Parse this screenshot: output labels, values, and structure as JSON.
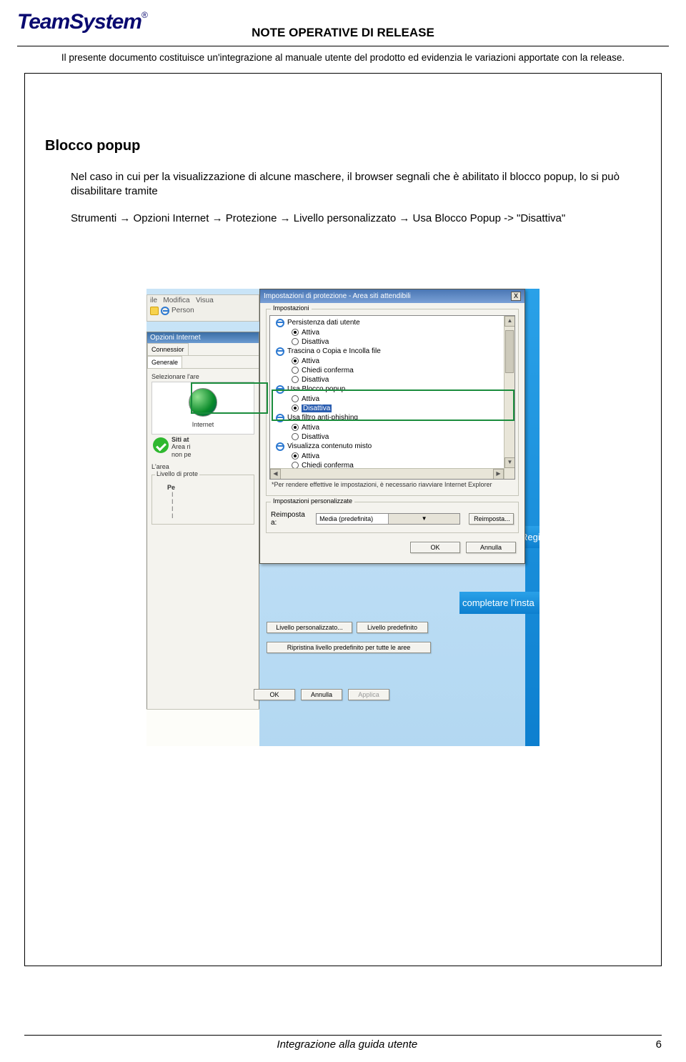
{
  "header": {
    "logo_text": "TeamSystem",
    "logo_reg": "®",
    "doc_title": "NOTE OPERATIVE DI RELEASE",
    "subtitle": "Il presente documento costituisce un'integrazione al manuale utente del prodotto ed evidenzia le variazioni apportate con la release."
  },
  "section": {
    "heading": "Blocco popup",
    "paragraph": "Nel caso in cui per la visualizzazione di alcune maschere, il browser segnali che è abilitato il blocco popup, lo si può disabilitare tramite",
    "path": "Strumenti → Opzioni Internet → Protezione → Livello personalizzato → Usa Blocco Popup -> \"Disattiva\""
  },
  "ie_menu": {
    "file": "ile",
    "modifica": "Modifica",
    "visua": "Visua",
    "person": "Person"
  },
  "opzioni": {
    "title": "Opzioni Internet",
    "tab_conn": "Connessior",
    "tab_gen": "Generale",
    "sel_area": "Selezionare l'are",
    "internet": "Internet",
    "siti_at": "Siti at",
    "area_ri": "Area ri",
    "non_pe": "non pe",
    "larea": "L'area",
    "livello_prote": "Livello di prote",
    "pe": "Pe",
    "btn_liv_pers": "Livello personalizzato...",
    "btn_liv_pred": "Livello predefinito",
    "btn_riprist": "Ripristina livello predefinito per tutte le aree",
    "btn_ok": "OK",
    "btn_annulla": "Annulla",
    "btn_applica": "Applica"
  },
  "dialog": {
    "title": "Impostazioni di protezione - Area siti attendibili",
    "close": "X",
    "grp_impost": "Impostazioni",
    "items": {
      "persist": "Persistenza dati utente",
      "attiva": "Attiva",
      "disatt": "Disattiva",
      "trascina": "Trascina o Copia e Incolla file",
      "chiedi": "Chiedi conferma",
      "usablocco": "Usa Blocco popup",
      "usafiltro": "Usa filtro anti-phishing",
      "visualizza": "Visualizza contenuto misto"
    },
    "note": "*Per rendere effettive le impostazioni, è necessario riavviare Internet Explorer",
    "grp_pers": "Impostazioni personalizzate",
    "reimp_label": "Reimposta a:",
    "combo_val": "Media (predefinita)",
    "btn_reimp": "Reimposta...",
    "btn_ok": "OK",
    "btn_ann": "Annulla"
  },
  "bluestrip": {
    "line1": "Regi",
    "line2": "completare l'insta"
  },
  "footer": {
    "center": "Integrazione alla guida utente",
    "page": "6"
  }
}
